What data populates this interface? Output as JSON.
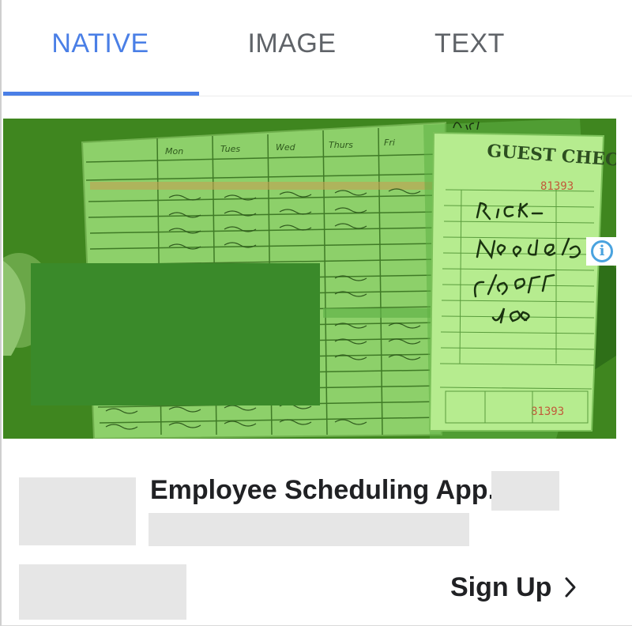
{
  "tabs": [
    {
      "label": "NATIVE",
      "active": true
    },
    {
      "label": "IMAGE",
      "active": false
    },
    {
      "label": "TEXT",
      "active": false
    }
  ],
  "colors": {
    "accent": "#4a7fe6",
    "image_tint": "#3e8a1d",
    "placeholder": "#e6e6e6",
    "info": "#4aa3df"
  },
  "ad": {
    "image_subject": "schedule-sheet-and-guest-check",
    "photo_text": {
      "days": [
        "Mon",
        "Tues",
        "Wed",
        "Thurs",
        "Fri"
      ],
      "guest_check": "GUEST CHECK",
      "check_number": "81393",
      "note": "Rick- NEED 6/28- 6/30 OFF Joe"
    },
    "headline": "Employee Scheduling App.",
    "cta": "Sign Up",
    "info_icon": "info-icon",
    "cta_icon": "chevron-right-icon"
  }
}
